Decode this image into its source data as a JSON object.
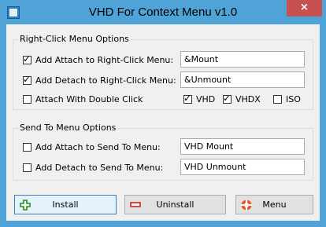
{
  "window": {
    "title": "VHD For Context Menu v1.0",
    "close_label": "×"
  },
  "right_click_group": {
    "label": "Right-Click Menu Options",
    "attach": {
      "label": "Add Attach to Right-Click Menu:",
      "checked": true,
      "value": "&Mount"
    },
    "detach": {
      "label": "Add Detach to Right-Click Menu:",
      "checked": true,
      "value": "&Unmount"
    },
    "double_click": {
      "label": "Attach With Double Click",
      "checked": false
    },
    "vhd": {
      "label": "VHD",
      "checked": true
    },
    "vhdx": {
      "label": "VHDX",
      "checked": true
    },
    "iso": {
      "label": "ISO",
      "checked": false
    }
  },
  "send_to_group": {
    "label": "Send To Menu Options",
    "attach": {
      "label": "Add Attach to Send To Menu:",
      "checked": false,
      "value": "VHD Mount"
    },
    "detach": {
      "label": "Add Detach to Send To Menu:",
      "checked": false,
      "value": "VHD Unmount"
    }
  },
  "buttons": {
    "install": "Install",
    "uninstall": "Uninstall",
    "menu": "Menu"
  }
}
